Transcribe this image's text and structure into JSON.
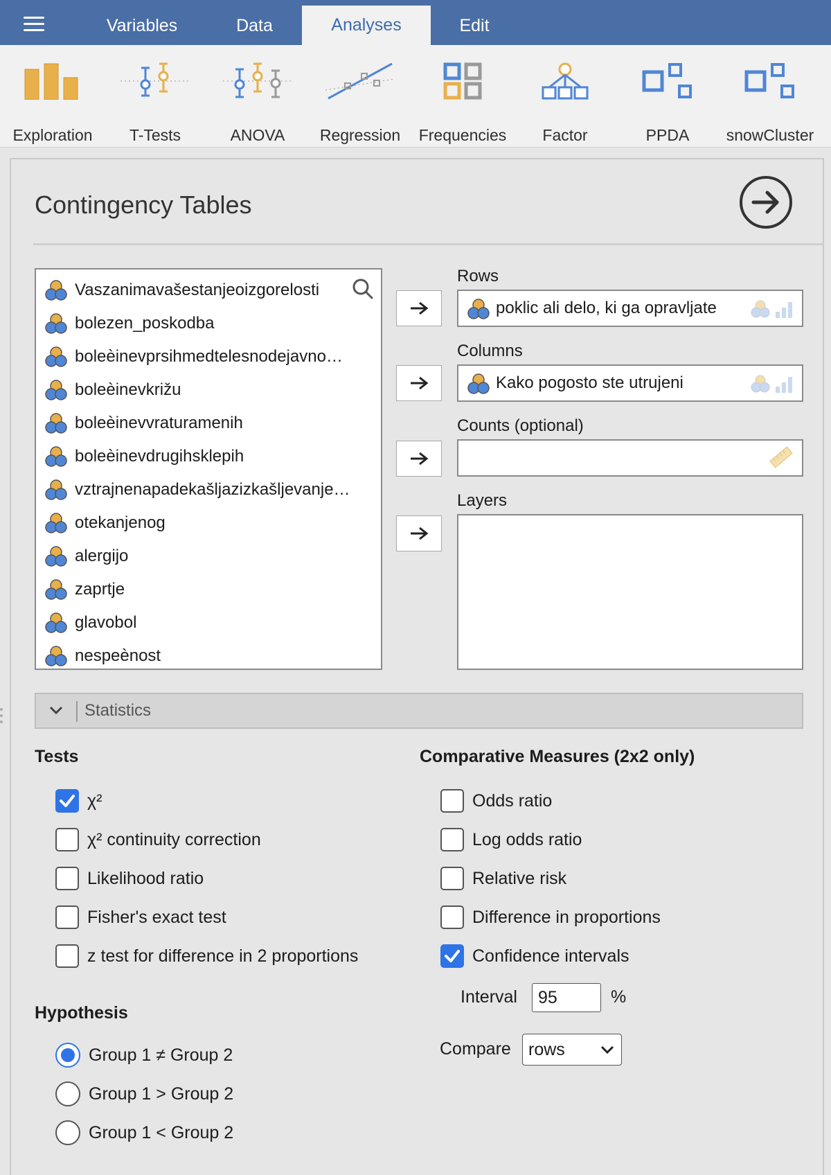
{
  "menu": {
    "tabs": [
      "Variables",
      "Data",
      "Analyses",
      "Edit"
    ],
    "active_tab": "Analyses"
  },
  "ribbon": {
    "items": [
      "Exploration",
      "T-Tests",
      "ANOVA",
      "Regression",
      "Frequencies",
      "Factor",
      "PPDA",
      "snowCluster"
    ]
  },
  "panel": {
    "title": "Contingency Tables"
  },
  "variables": [
    "Vaszanimavašestanjeoizgorelosti",
    "bolezen_poskodba",
    "boleèinevprsihmedtelesnodejavno…",
    "boleèinevkrižu",
    "boleèinevvraturamenih",
    "boleèinevdrugihsklepih",
    "vztrajnenapadekašljazizkašljevanje…",
    "otekanjenog",
    "alergijo",
    "zaprtje",
    "glavobol",
    "nespeènost"
  ],
  "rows": {
    "label": "Rows",
    "value": "poklic ali delo, ki ga opravljate"
  },
  "columns": {
    "label": "Columns",
    "value": "Kako pogosto ste utrujeni"
  },
  "counts": {
    "label": "Counts (optional)",
    "value": ""
  },
  "layers": {
    "label": "Layers"
  },
  "statistics": {
    "label": "Statistics"
  },
  "tests": {
    "heading": "Tests",
    "options": [
      {
        "label": "χ²",
        "checked": true
      },
      {
        "label": "χ² continuity correction",
        "checked": false
      },
      {
        "label": "Likelihood ratio",
        "checked": false
      },
      {
        "label": "Fisher's exact test",
        "checked": false
      },
      {
        "label": "z test for difference in 2 proportions",
        "checked": false
      }
    ]
  },
  "hypothesis": {
    "heading": "Hypothesis",
    "options": [
      {
        "label": "Group 1 ≠ Group 2",
        "selected": true
      },
      {
        "label": "Group 1 > Group 2",
        "selected": false
      },
      {
        "label": "Group 1 < Group 2",
        "selected": false
      }
    ]
  },
  "comparative": {
    "heading": "Comparative Measures (2x2 only)",
    "options": [
      {
        "label": "Odds ratio",
        "checked": false
      },
      {
        "label": "Log odds ratio",
        "checked": false
      },
      {
        "label": "Relative risk",
        "checked": false
      },
      {
        "label": "Difference in proportions",
        "checked": false
      },
      {
        "label": "Confidence intervals",
        "checked": true
      }
    ],
    "interval_label": "Interval",
    "interval_value": "95",
    "interval_unit": "%",
    "compare_label": "Compare",
    "compare_value": "rows"
  },
  "colors": {
    "topbar": "#4a6ea6",
    "accent": "#2f74e6",
    "nominal_orange": "#e8b04a",
    "nominal_blue": "#4f86d6"
  }
}
